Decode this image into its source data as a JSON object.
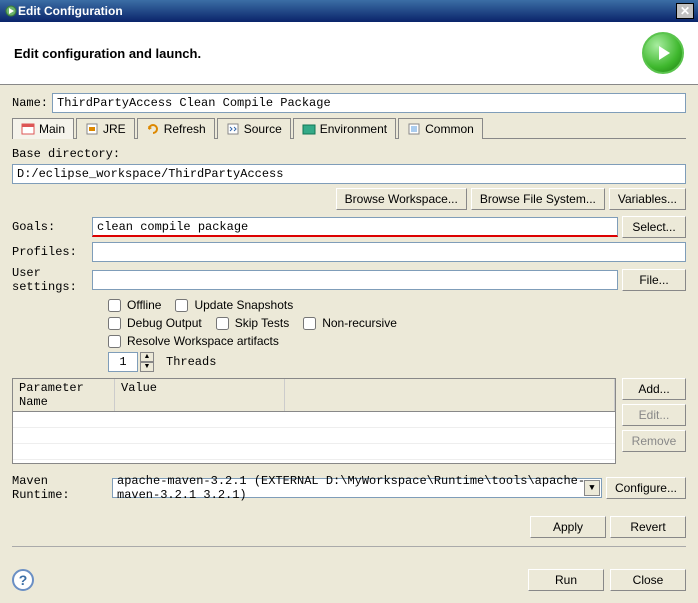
{
  "titlebar": {
    "title": "Edit Configuration"
  },
  "header": {
    "text": "Edit configuration and launch."
  },
  "name_label": "Name:",
  "name_value": "ThirdPartyAccess Clean Compile Package",
  "tabs": [
    {
      "label": "Main"
    },
    {
      "label": "JRE"
    },
    {
      "label": "Refresh"
    },
    {
      "label": "Source"
    },
    {
      "label": "Environment"
    },
    {
      "label": "Common"
    }
  ],
  "basedir_label": "Base directory:",
  "basedir_value": "D:/eclipse_workspace/ThirdPartyAccess",
  "buttons": {
    "browse_ws": "Browse Workspace...",
    "browse_fs": "Browse File System...",
    "variables": "Variables...",
    "select": "Select...",
    "file": "File...",
    "add": "Add...",
    "edit": "Edit...",
    "remove": "Remove",
    "configure": "Configure...",
    "apply": "Apply",
    "revert": "Revert",
    "run": "Run",
    "close": "Close"
  },
  "goals_label": "Goals:",
  "goals_value": "clean compile package",
  "profiles_label": "Profiles:",
  "profiles_value": "",
  "usersettings_label": "User settings:",
  "usersettings_value": "",
  "checkboxes": {
    "offline": "Offline",
    "update": "Update Snapshots",
    "debug": "Debug Output",
    "skip": "Skip Tests",
    "nonrec": "Non-recursive",
    "resolve": "Resolve Workspace artifacts"
  },
  "threads_value": "1",
  "threads_label": "Threads",
  "table": {
    "h1": "Parameter Name",
    "h2": "Value"
  },
  "runtime_label": "Maven Runtime:",
  "runtime_value": "apache-maven-3.2.1 (EXTERNAL D:\\MyWorkspace\\Runtime\\tools\\apache-maven-3.2.1 3.2.1)"
}
